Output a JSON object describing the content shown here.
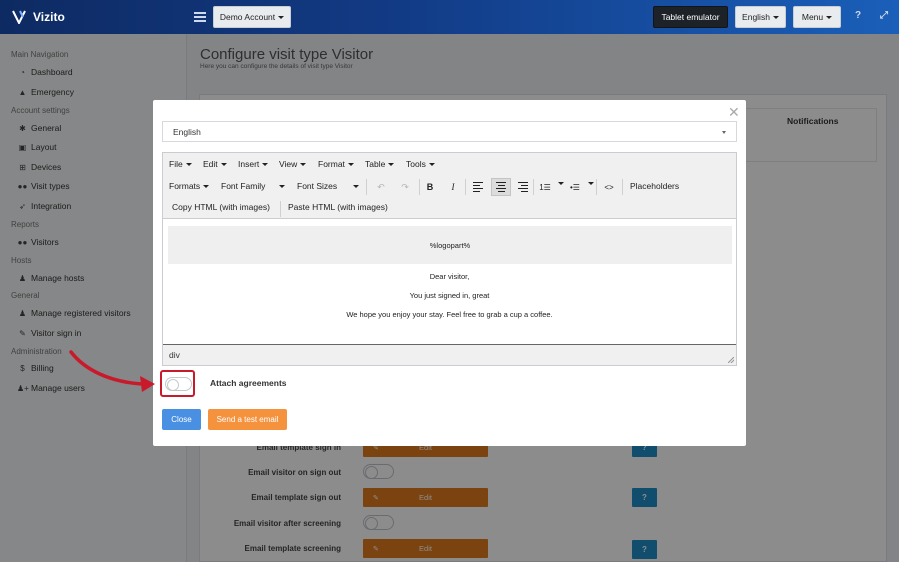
{
  "topbar": {
    "brand": "Vizito",
    "account_button": "Demo Account",
    "tablet_button": "Tablet emulator",
    "language_button": "English",
    "menu_button": "Menu",
    "help_icon": "question-icon",
    "expand_icon": "expand-icon"
  },
  "sidebar": {
    "sections": [
      {
        "title": "Main Navigation",
        "items": [
          {
            "label": "Dashboard",
            "icon": "dashboard-icon"
          },
          {
            "label": "Emergency",
            "icon": "warning-icon"
          }
        ]
      },
      {
        "title": "Account settings",
        "items": [
          {
            "label": "General",
            "icon": "gear-icon"
          },
          {
            "label": "Layout",
            "icon": "image-icon"
          },
          {
            "label": "Devices",
            "icon": "sitemap-icon"
          },
          {
            "label": "Visit types",
            "icon": "users-icon"
          },
          {
            "label": "Integration",
            "icon": "rocket-icon"
          }
        ]
      },
      {
        "title": "Reports",
        "items": [
          {
            "label": "Visitors",
            "icon": "users-icon"
          }
        ]
      },
      {
        "title": "Hosts",
        "items": [
          {
            "label": "Manage hosts",
            "icon": "person-icon"
          }
        ]
      },
      {
        "title": "General",
        "items": [
          {
            "label": "Manage registered visitors",
            "icon": "person-icon"
          },
          {
            "label": "Visitor sign in",
            "icon": "pencil-icon"
          }
        ]
      },
      {
        "title": "Administration",
        "items": [
          {
            "label": "Billing",
            "icon": "dollar-icon"
          },
          {
            "label": "Manage users",
            "icon": "user-plus-icon"
          }
        ]
      }
    ]
  },
  "page": {
    "title": "Configure visit type Visitor",
    "subtitle": "Here you can configure the details of visit type Visitor",
    "notifications_header": "Notifications",
    "rows": [
      {
        "label": "Email template sign in",
        "kind": "edit",
        "edit_label": "Edit",
        "help": "?"
      },
      {
        "label": "Email visitor on sign out",
        "kind": "toggle"
      },
      {
        "label": "Email template sign out",
        "kind": "edit",
        "edit_label": "Edit",
        "help": "?"
      },
      {
        "label": "Email visitor after screening",
        "kind": "toggle"
      },
      {
        "label": "Email template screening",
        "kind": "edit",
        "edit_label": "Edit",
        "help": "?"
      }
    ]
  },
  "modal": {
    "language": "English",
    "menubar": [
      "File",
      "Edit",
      "Insert",
      "View",
      "Format",
      "Table",
      "Tools"
    ],
    "toolbar": {
      "formats": "Formats",
      "font_family": "Font Family",
      "font_sizes": "Font Sizes",
      "placeholders": "Placeholders",
      "copy_html": "Copy HTML (with images)",
      "paste_html": "Paste HTML (with images)",
      "code_icon": "<>",
      "bold": "B",
      "italic": "I"
    },
    "content": {
      "logo_placeholder": "%logopart%",
      "line1": "Dear visitor,",
      "line2": "You just signed in, great",
      "line3": "We hope you enjoy your stay. Feel free to grab a cup a coffee."
    },
    "status_path": "div",
    "attach_label": "Attach agreements",
    "attach_enabled": false,
    "close_button": "Close",
    "test_button": "Send a test email",
    "highlight_color": "#c91a2b"
  }
}
